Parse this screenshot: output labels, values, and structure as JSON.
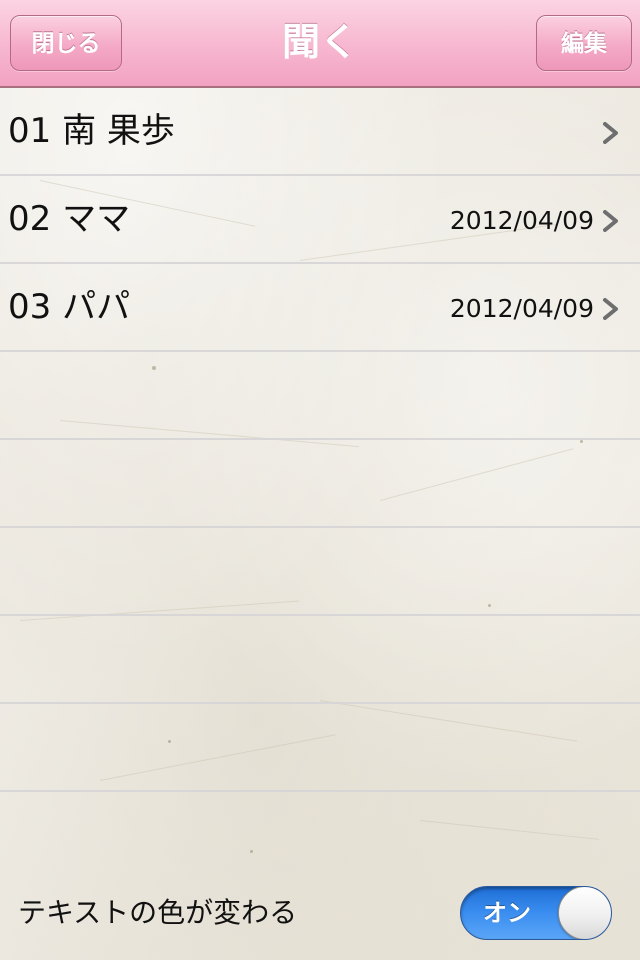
{
  "navbar": {
    "close_label": "閉じる",
    "title": "聞く",
    "edit_label": "編集"
  },
  "list": {
    "items": [
      {
        "title": "01 南 果歩",
        "date": ""
      },
      {
        "title": "02 ママ",
        "date": "2012/04/09"
      },
      {
        "title": "03 パパ",
        "date": "2012/04/09"
      }
    ]
  },
  "settings": {
    "text_color_label": "テキストの色が変わる",
    "toggle_label": "オン",
    "toggle_on": true
  },
  "colors": {
    "navbar_pink": "#f7b9d1",
    "toggle_blue": "#3b8ef0",
    "chevron_gray": "#6e6e6e"
  },
  "icons": {
    "row_disclosure": "chevron-right-icon"
  }
}
